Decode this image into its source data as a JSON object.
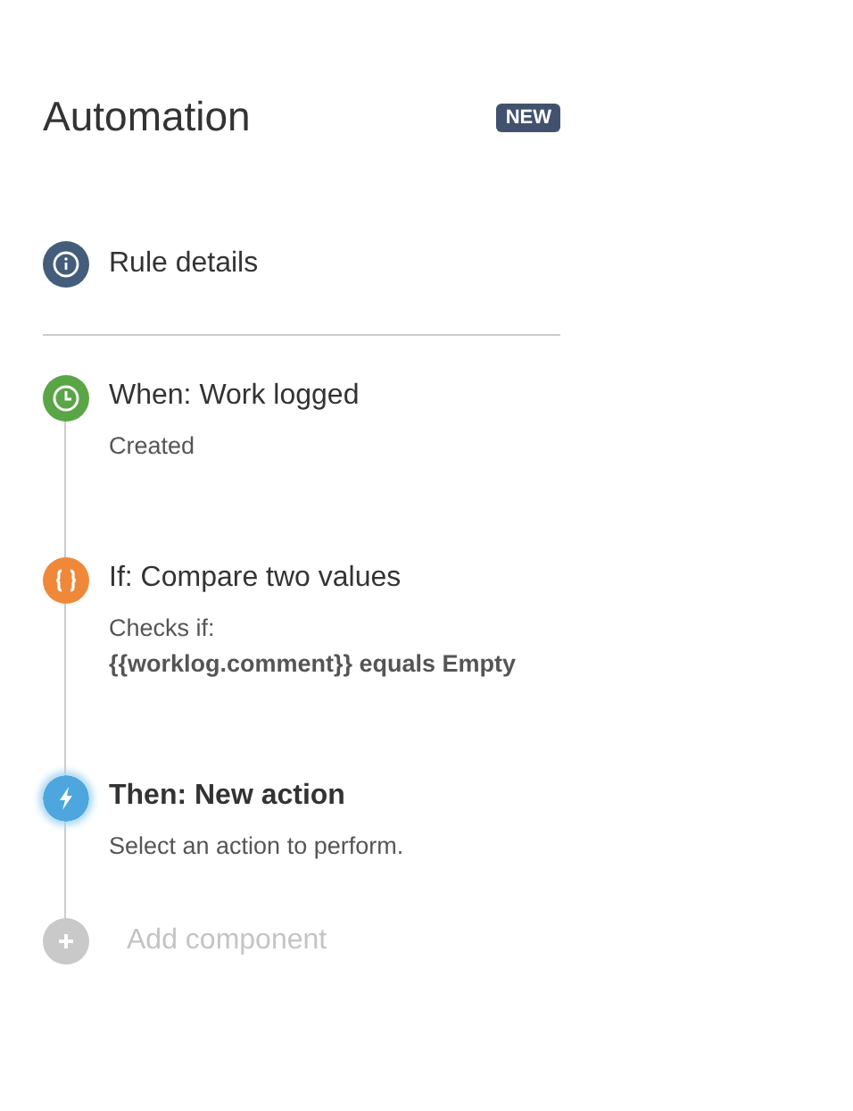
{
  "header": {
    "title": "Automation",
    "badge": "NEW"
  },
  "rule_details": {
    "label": "Rule details"
  },
  "steps": [
    {
      "kind": "trigger",
      "title": "When: Work logged",
      "color": "#5aa545",
      "selected": false,
      "lines": [
        {
          "text": "Created",
          "emphasis": false
        }
      ]
    },
    {
      "kind": "condition",
      "title": "If: Compare two values",
      "color": "#f0883a",
      "selected": false,
      "lines": [
        {
          "text": "Checks if:",
          "emphasis": false
        },
        {
          "text": "{{worklog.comment}} equals Empty",
          "emphasis": true
        }
      ]
    },
    {
      "kind": "action",
      "title": "Then: New action",
      "color": "#4da6de",
      "selected": true,
      "lines": [
        {
          "text": "Select an action to perform.",
          "emphasis": false
        }
      ]
    }
  ],
  "add_component": {
    "label": "Add component",
    "disabled": true
  }
}
